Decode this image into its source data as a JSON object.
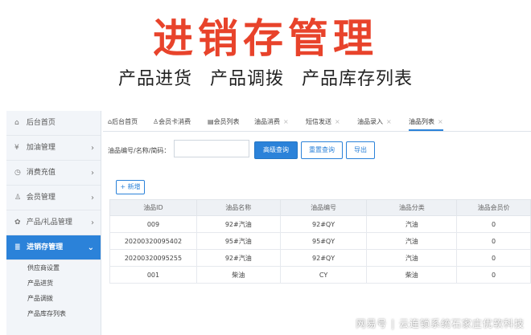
{
  "banner": {
    "title": "进销存管理",
    "subtitle": "产品进货  产品调拨  产品库存列表"
  },
  "sidebar": {
    "items": [
      {
        "icon": "home-icon",
        "glyph": "⌂",
        "label": "后台首页",
        "chevron": ""
      },
      {
        "icon": "yen-icon",
        "glyph": "¥",
        "label": "加油管理",
        "chevron": "›"
      },
      {
        "icon": "gauge-icon",
        "glyph": "◷",
        "label": "消费充值",
        "chevron": "›"
      },
      {
        "icon": "user-icon",
        "glyph": "♙",
        "label": "会员管理",
        "chevron": "›"
      },
      {
        "icon": "gift-icon",
        "glyph": "✿",
        "label": "产品/礼品管理",
        "chevron": "›"
      },
      {
        "icon": "stack-icon",
        "glyph": "≣",
        "label": "进销存管理",
        "chevron": "⌄"
      }
    ],
    "subitems": [
      "供应商设置",
      "产品进货",
      "产品调拨",
      "产品库存列表"
    ]
  },
  "tabs": [
    {
      "icon": "⌂",
      "label": "后台首页",
      "close": ""
    },
    {
      "icon": "♙",
      "label": "会员卡消费",
      "close": ""
    },
    {
      "icon": "▤",
      "label": "会员列表",
      "close": ""
    },
    {
      "icon": "",
      "label": "油品消费",
      "close": "×"
    },
    {
      "icon": "",
      "label": "短信发送",
      "close": "×"
    },
    {
      "icon": "",
      "label": "油品录入",
      "close": "×"
    },
    {
      "icon": "",
      "label": "油品列表",
      "close": "×"
    }
  ],
  "search": {
    "label": "油品编号/名称/简码：",
    "value": "",
    "query_label": "高级查询",
    "reset_label": "重置查询",
    "export_label": "导出"
  },
  "add_label": "+ 新增",
  "table": {
    "headers": [
      "油品ID",
      "油品名称",
      "油品编号",
      "油品分类",
      "油品会员价"
    ],
    "rows": [
      [
        "009",
        "92#汽油",
        "92#QY",
        "汽油",
        "0"
      ],
      [
        "20200320095402",
        "95#汽油",
        "95#QY",
        "汽油",
        "0"
      ],
      [
        "20200320095255",
        "92#汽油",
        "92#QY",
        "汽油",
        "0"
      ],
      [
        "001",
        "柴油",
        "CY",
        "柴油",
        "0"
      ]
    ]
  },
  "watermark": "网易号 | 云连锁系统石家庄优软科技",
  "colors": {
    "accent": "#2b82d9",
    "title": "#e8432b"
  }
}
